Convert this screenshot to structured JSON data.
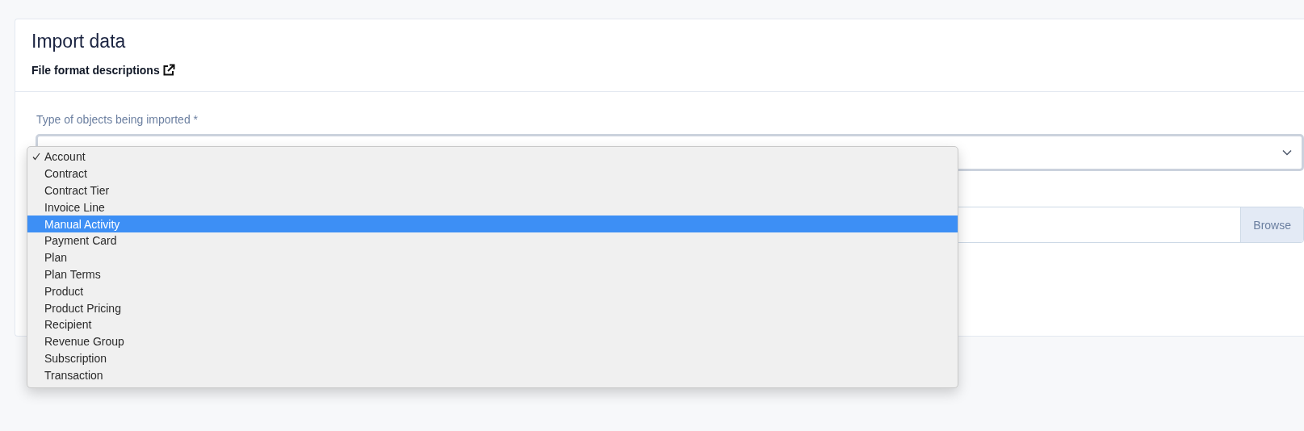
{
  "card": {
    "title": "Import data",
    "link": "File format descriptions"
  },
  "type_field": {
    "label": "Type of objects being imported *"
  },
  "file_field": {
    "button": "Browse"
  },
  "menu": {
    "options": [
      {
        "label": "Account",
        "checked": true,
        "highlighted": false
      },
      {
        "label": "Contract",
        "checked": false,
        "highlighted": false
      },
      {
        "label": "Contract Tier",
        "checked": false,
        "highlighted": false
      },
      {
        "label": "Invoice Line",
        "checked": false,
        "highlighted": false
      },
      {
        "label": "Manual Activity",
        "checked": false,
        "highlighted": true
      },
      {
        "label": "Payment Card",
        "checked": false,
        "highlighted": false
      },
      {
        "label": "Plan",
        "checked": false,
        "highlighted": false
      },
      {
        "label": "Plan Terms",
        "checked": false,
        "highlighted": false
      },
      {
        "label": "Product",
        "checked": false,
        "highlighted": false
      },
      {
        "label": "Product Pricing",
        "checked": false,
        "highlighted": false
      },
      {
        "label": "Recipient",
        "checked": false,
        "highlighted": false
      },
      {
        "label": "Revenue Group",
        "checked": false,
        "highlighted": false
      },
      {
        "label": "Subscription",
        "checked": false,
        "highlighted": false
      },
      {
        "label": "Transaction",
        "checked": false,
        "highlighted": false
      }
    ]
  }
}
